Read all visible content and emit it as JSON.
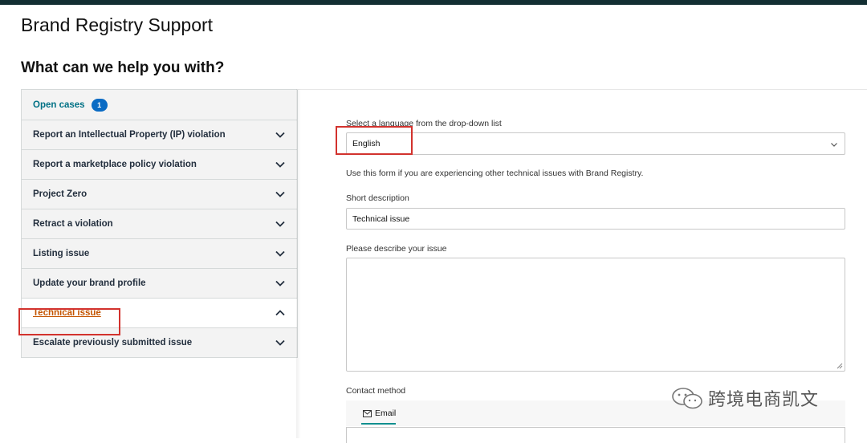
{
  "page": {
    "title": "Brand Registry Support",
    "subtitle": "What can we help you with?"
  },
  "sidebar": {
    "open_cases": {
      "label": "Open cases",
      "count": "1"
    },
    "items": [
      {
        "label": "Report an Intellectual Property (IP) violation",
        "state": "collapsed"
      },
      {
        "label": "Report a marketplace policy violation",
        "state": "collapsed"
      },
      {
        "label": "Project Zero",
        "state": "collapsed"
      },
      {
        "label": "Retract a violation",
        "state": "collapsed"
      },
      {
        "label": "Listing issue",
        "state": "collapsed"
      },
      {
        "label": "Update your brand profile",
        "state": "collapsed"
      },
      {
        "label": "Technical issue",
        "state": "expanded"
      },
      {
        "label": "Escalate previously submitted issue",
        "state": "collapsed"
      }
    ]
  },
  "form": {
    "language_label": "Select a language from the drop-down list",
    "language_value": "English",
    "intro_text": "Use this form if you are experiencing other technical issues with Brand Registry.",
    "short_description_label": "Short description",
    "short_description_value": "Technical issue",
    "describe_label": "Please describe your issue",
    "describe_value": "",
    "contact_method_label": "Contact method",
    "contact_tab_email": "Email"
  },
  "watermark": {
    "text": "跨境电商凯文"
  },
  "colors": {
    "accent_link": "#007185",
    "active_link": "#c45500",
    "highlight": "#d2322d",
    "badge": "#0a6bc4",
    "tab_underline": "#0a8f8f"
  }
}
